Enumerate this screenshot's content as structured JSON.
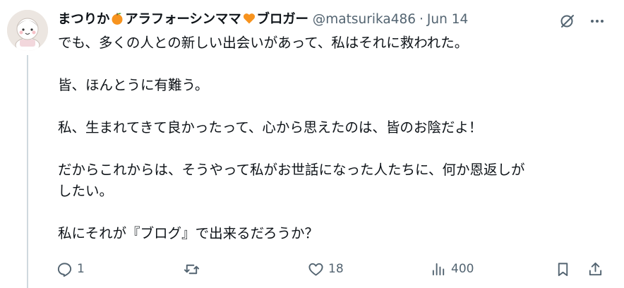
{
  "author": {
    "name_part1": "まつりか",
    "name_part2": "アラフォーシンママ",
    "name_part3": "ブロガー",
    "handle": "@matsurika486",
    "separator": "·",
    "time": "Jun 14"
  },
  "icons": {
    "avatar": "avatar",
    "name_emoji_1": "orange-emoji",
    "name_emoji_2": "orange-heart-emoji",
    "top_right": [
      "grok-icon",
      "more-icon"
    ],
    "actions": [
      "reply-icon",
      "retweet-icon",
      "like-icon",
      "views-icon",
      "bookmark-icon",
      "share-icon"
    ]
  },
  "body": {
    "line1": "でも、多くの人との新しい出会いがあって、私はそれに救われた。",
    "line2": "皆、ほんとうに有難う。",
    "line3": "私、生まれてきて良かったって、心から思えたのは、皆のお陰だよ！",
    "line4a": "だからこれからは、そうやって私がお世話になった人たちに、何か恩返しが",
    "line4b": "したい。",
    "line5": "私にそれが『ブログ』で出来るだろうか？"
  },
  "metrics": {
    "replies": "1",
    "retweets": "",
    "likes": "18",
    "views": "400"
  },
  "colors": {
    "text": "#0f1419",
    "secondary": "#536471",
    "thread_line": "#cfd9de",
    "orange": "#f7931e"
  }
}
